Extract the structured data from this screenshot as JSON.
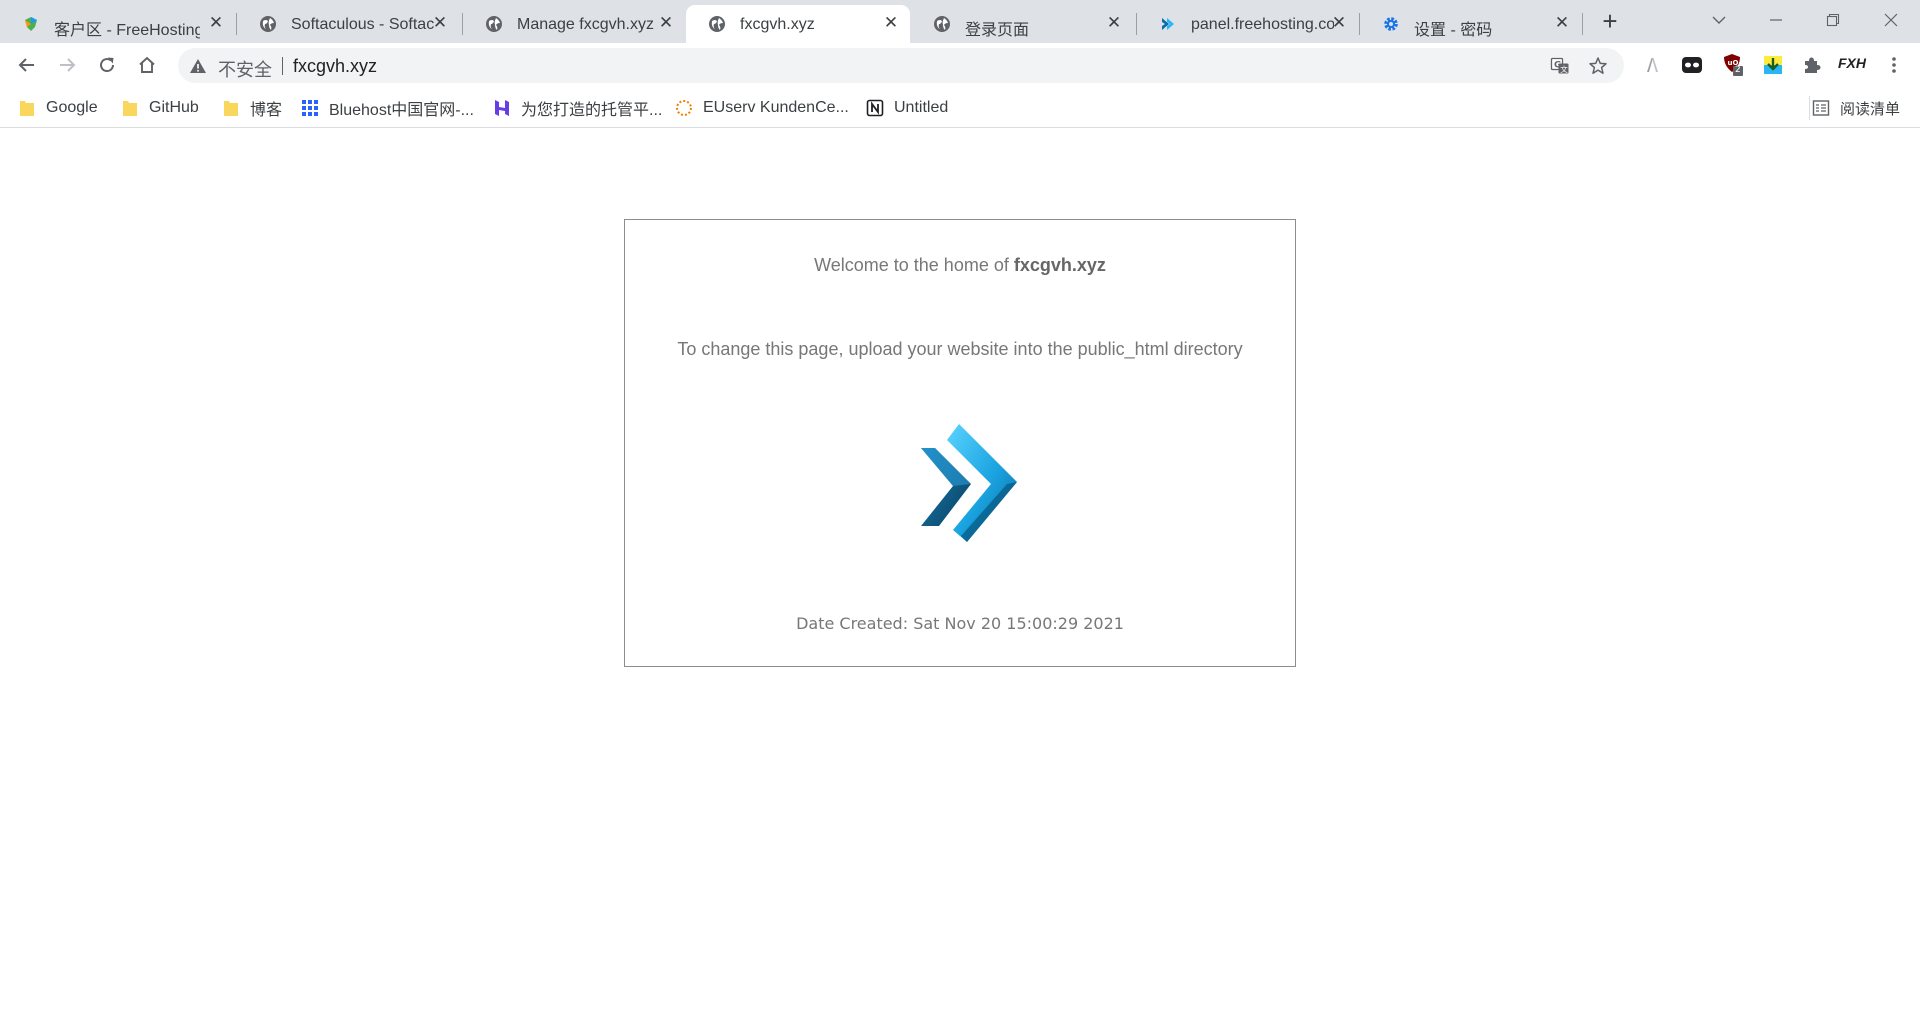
{
  "browser": {
    "tabs": [
      {
        "title": "客户区 - FreeHosting",
        "favicon": "freehosting-logo-icon",
        "active": false
      },
      {
        "title": "Softaculous - Softac",
        "favicon": "globe-icon",
        "active": false
      },
      {
        "title": "Manage fxcgvh.xyz",
        "favicon": "globe-icon",
        "active": false
      },
      {
        "title": "fxcgvh.xyz",
        "favicon": "globe-icon",
        "active": true
      },
      {
        "title": "登录页面",
        "favicon": "globe-icon",
        "active": false
      },
      {
        "title": "panel.freehosting.co",
        "favicon": "chevron-logo-icon",
        "active": false
      },
      {
        "title": "设置 - 密码",
        "favicon": "gear-icon",
        "active": false
      }
    ],
    "omnibox": {
      "security_label": "不安全",
      "url": "fxcgvh.xyz"
    },
    "extensions": {
      "ublock_badge": "2"
    },
    "profile_label": "FXH",
    "bookmarks": [
      {
        "label": "Google",
        "icon": "folder-icon"
      },
      {
        "label": "GitHub",
        "icon": "folder-icon"
      },
      {
        "label": "博客",
        "icon": "folder-icon"
      },
      {
        "label": "Bluehost中国官网-...",
        "icon": "grid-icon"
      },
      {
        "label": "为您打造的托管平...",
        "icon": "hostinger-logo-icon"
      },
      {
        "label": "EUserv KundenCe...",
        "icon": "spinner-logo-icon"
      },
      {
        "label": "Untitled",
        "icon": "notion-logo-icon"
      }
    ],
    "reading_list_label": "阅读清单",
    "colors": {
      "tabstrip": "#dee1e6",
      "omnibox": "#f1f3f4",
      "folder": "#f9d75d",
      "accent_blue": "#1a73e8"
    }
  },
  "page": {
    "welcome_prefix": "Welcome to the home of ",
    "domain": "fxcgvh.xyz",
    "instructions": "To change this page, upload your website into the public_html directory",
    "logo": "double-chevron-logo-icon",
    "date_created": "Date Created: Sat Nov 20 15:00:29 2021",
    "colors": {
      "text": "#777777",
      "border": "#8c8c8c",
      "logo_light": "#29b6f6",
      "logo_dark": "#0b4f7c"
    }
  }
}
